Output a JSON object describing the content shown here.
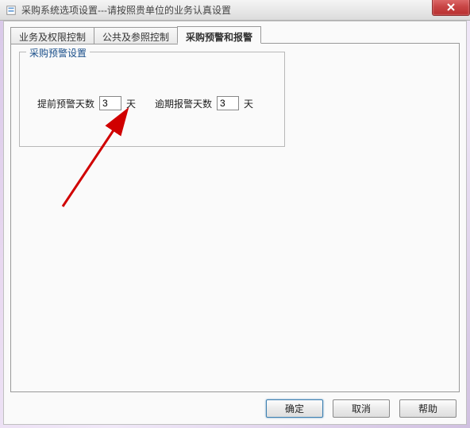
{
  "window": {
    "title": "采购系统选项设置---请按照贵单位的业务认真设置"
  },
  "tabs": {
    "tab1": "业务及权限控制",
    "tab2": "公共及参照控制",
    "tab3": "采购预警和报警"
  },
  "groupbox": {
    "legend": "采购预警设置"
  },
  "fields": {
    "pre_warn_label": "提前预警天数",
    "pre_warn_value": "3",
    "pre_warn_unit": "天",
    "overdue_label": "逾期报警天数",
    "overdue_value": "3",
    "overdue_unit": "天"
  },
  "buttons": {
    "ok": "确定",
    "cancel": "取消",
    "help": "帮助"
  }
}
